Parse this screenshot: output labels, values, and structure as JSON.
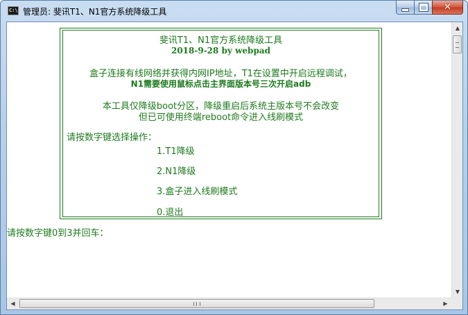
{
  "window": {
    "icon_text": "C:\\",
    "title": "管理员: 斐讯T1、N1官方系统降级工具",
    "controls": {
      "close": "✕"
    }
  },
  "console": {
    "header_title": "斐讯T1、N1官方系统降级工具",
    "header_date": "2018-9-28  by webpad",
    "intro_line1": "盒子连接有线网络并获得内网IP地址，T1在设置中开启远程调试，",
    "intro_line2": "N1需要使用鼠标点击主界面版本号三次开启adb",
    "note_line1": "本工具仅降级boot分区，降级重启后系统主版本号不会改变",
    "note_line2": "但已可使用终端reboot命令进入线刷模式",
    "select_prompt": "请按数字键选择操作：",
    "options": [
      {
        "label": "1.T1降级"
      },
      {
        "label": "2.N1降级"
      },
      {
        "label": "3.盒子进入线刷模式"
      },
      {
        "label": "0.退出"
      }
    ],
    "input_prompt": "请按数字键0到3并回车："
  },
  "scrollbars": {
    "up": "▲",
    "down": "▼",
    "left": "◀",
    "right": "▶",
    "h_grip": "III"
  },
  "colors": {
    "console_text": "#1e7a1e",
    "background": "#ffffff"
  }
}
